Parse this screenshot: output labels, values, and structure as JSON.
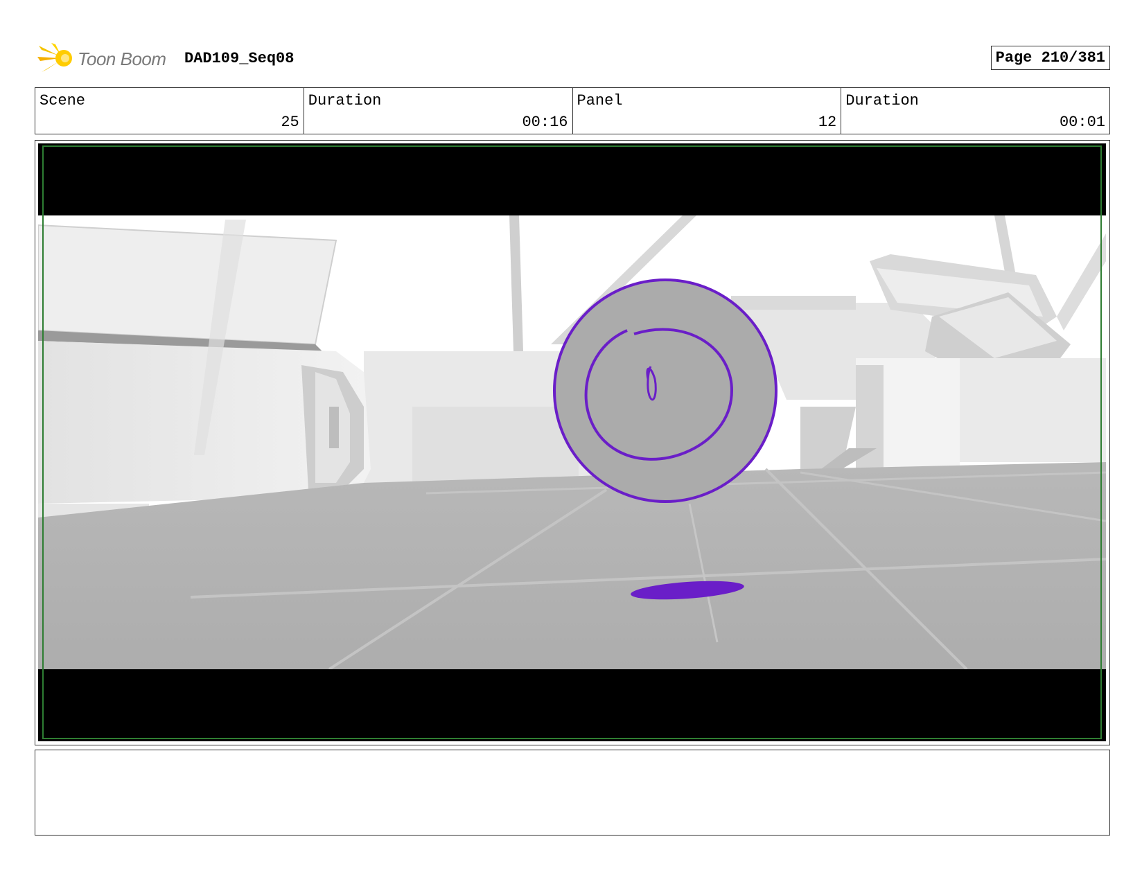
{
  "header": {
    "logo_text": "Toon Boom",
    "project": "DAD109_Seq08",
    "page": "Page 210/381"
  },
  "info": {
    "scene_label": "Scene",
    "scene_value": "25",
    "scene_duration_label": "Duration",
    "scene_duration_value": "00:16",
    "panel_label": "Panel",
    "panel_value": "12",
    "panel_duration_label": "Duration",
    "panel_duration_value": "00:01"
  },
  "colors": {
    "sketch_purple": "#6a1ec8",
    "safe_frame_green": "#2e7d32",
    "letterbox": "#000000"
  },
  "notes": {
    "text": ""
  }
}
